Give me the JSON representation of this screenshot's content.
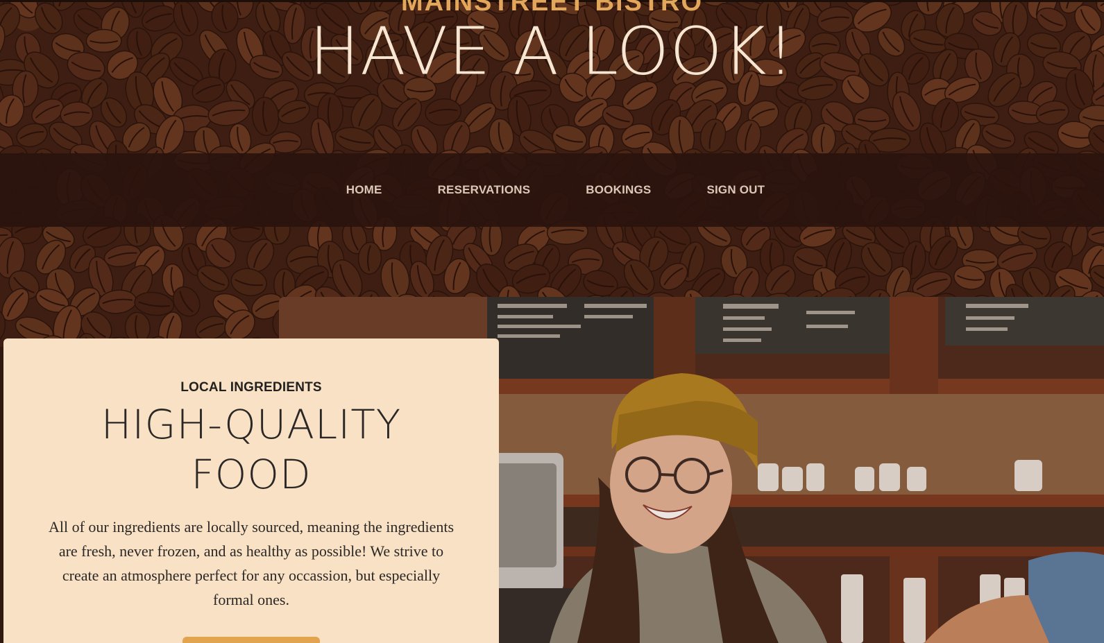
{
  "brand": "MAINSTREET BISTRO",
  "hero": {
    "title": "HAVE A LOOK!"
  },
  "nav": {
    "items": [
      {
        "label": "HOME"
      },
      {
        "label": "RESERVATIONS"
      },
      {
        "label": "BOOKINGS"
      },
      {
        "label": "SIGN OUT"
      }
    ]
  },
  "intro": {
    "eyebrow": "LOCAL INGREDIENTS",
    "heading_line1": "HIGH-QUALITY",
    "heading_line2": "FOOD",
    "body": "All of our ingredients are locally sourced, meaning the ingredients are fresh, never frozen, and as healthy as possible! We strive to create an atmosphere perfect for any occassion, but especially formal ones.",
    "button_label": ""
  },
  "photo": {
    "icon": "barista-photo"
  },
  "colors": {
    "accent": "#e2a75a",
    "nav_bg": "#2a130e",
    "card_bg": "#f8e1c5",
    "hero_text": "#f6e6d2"
  }
}
